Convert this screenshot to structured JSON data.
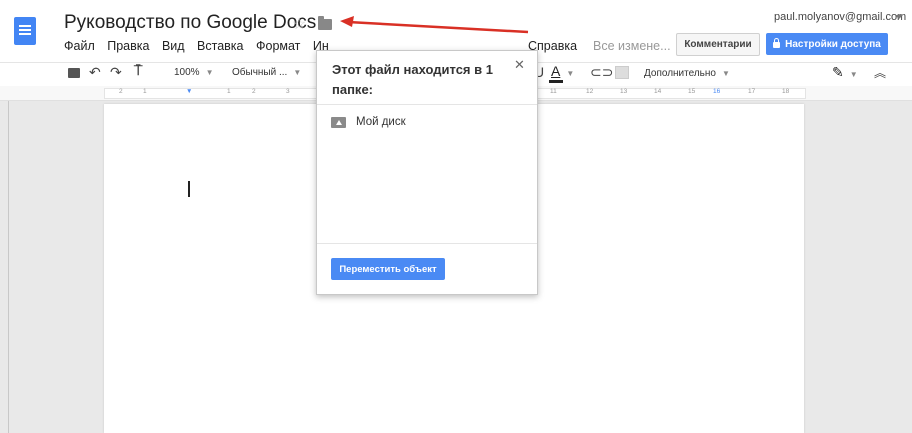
{
  "header": {
    "doc_title": "Руководство по Google Docs",
    "account": "paul.molyanov@gmail.com",
    "save_status": "Все измене...",
    "comments_label": "Комментарии",
    "share_label": "Настройки доступа"
  },
  "menu": {
    "items": [
      "Файл",
      "Правка",
      "Вид",
      "Вставка",
      "Формат",
      "Ин"
    ],
    "help": "Справка"
  },
  "toolbar": {
    "zoom": "100%",
    "style": "Обычный ...",
    "text_color_letter": "A",
    "underline_letter": "U",
    "more": "Дополнительно"
  },
  "ruler": {
    "ticks": [
      "2",
      "1",
      "1",
      "2",
      "3",
      "11",
      "12",
      "13",
      "14",
      "15",
      "16",
      "17",
      "18"
    ]
  },
  "popup": {
    "title": "Этот файл находится в 1 папке:",
    "folder_name": "Мой диск",
    "move_button": "Переместить объект"
  },
  "colors": {
    "accent": "#4a8af4",
    "logo": "#4285f4",
    "annotation_arrow": "#d93025"
  },
  "icons": [
    "docs-logo-icon",
    "star-icon",
    "folder-icon",
    "print-icon",
    "undo-icon",
    "redo-icon",
    "paint-format-icon",
    "link-icon",
    "comment-icon",
    "pen-icon",
    "collapse-icon",
    "close-icon",
    "drive-icon",
    "lock-icon"
  ]
}
